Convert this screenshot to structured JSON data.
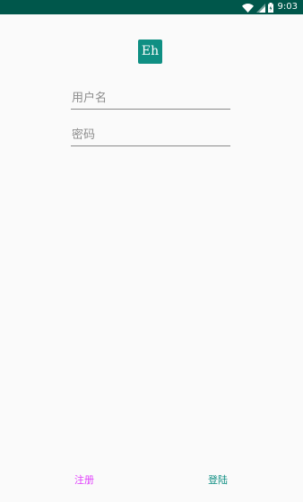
{
  "status_bar": {
    "time": "9:03",
    "icons": [
      "wifi-icon",
      "signal-icon",
      "battery-icon"
    ]
  },
  "logo": {
    "text": "Eh"
  },
  "form": {
    "username_placeholder": "用户名",
    "password_placeholder": "密码"
  },
  "actions": {
    "register_label": "注册",
    "login_label": "登陆"
  },
  "colors": {
    "status_bar": "#00574b",
    "accent": "#0f8f83",
    "register": "#e040fb",
    "background": "#fafafa"
  }
}
